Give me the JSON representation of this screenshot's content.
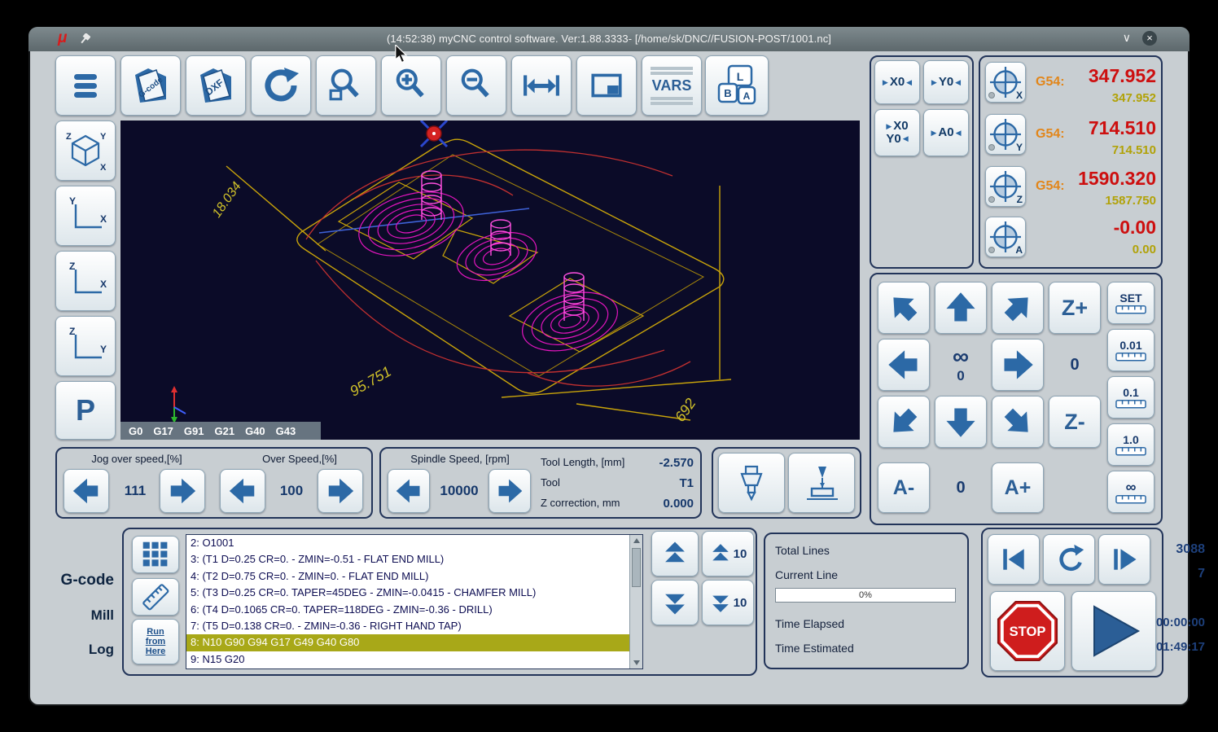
{
  "titlebar": {
    "logo": "μ",
    "title": "(14:52:38) myCNC control software. Ver:1.88.3333- [/home/sk/DNC//FUSION-POST/1001.nc]"
  },
  "glyphs": {
    "minimize": "∨",
    "close": "×",
    "tri_right": "▶",
    "tri_left": "◀"
  },
  "toolbar": {
    "gcode": "G-code",
    "dxf": "DXF",
    "vars": "VARS",
    "keys": {
      "l": "L",
      "b": "B",
      "a": "A"
    }
  },
  "views": {
    "iso": {
      "x": "X",
      "y": "Y",
      "z": "Z"
    },
    "xy": {
      "v": "Y",
      "h": "X"
    },
    "xz": {
      "v": "Z",
      "h": "X"
    },
    "yz": {
      "v": "Z",
      "h": "Y"
    },
    "park": "P"
  },
  "viz": {
    "codes": [
      "G0",
      "G17",
      "G91",
      "G21",
      "G40",
      "G43"
    ],
    "dim_left": "18.034",
    "dim_bottom": "95.751",
    "dim_right": "692"
  },
  "zeroing": {
    "x0": "X0",
    "y0": "Y0",
    "x0y0": [
      "X0",
      "Y0"
    ],
    "a0": "A0"
  },
  "dro": {
    "axes": [
      {
        "axis": "X",
        "offset": "G54:",
        "main": "347.952",
        "sub": "347.952"
      },
      {
        "axis": "Y",
        "offset": "G54:",
        "main": "714.510",
        "sub": "714.510"
      },
      {
        "axis": "Z",
        "offset": "G54:",
        "main": "1590.320",
        "sub": "1587.750"
      },
      {
        "axis": "A",
        "offset": "",
        "main": "-0.00",
        "sub": "0.00"
      }
    ]
  },
  "jog": {
    "z_plus": "Z+",
    "z_minus": "Z-",
    "a_minus": "A-",
    "a_plus": "A+",
    "center_top": "∞",
    "center_bottom": "0",
    "col4_value": "0",
    "a_value": "0",
    "steps": [
      "SET",
      "0.01",
      "0.1",
      "1.0",
      "∞"
    ]
  },
  "overrides": {
    "jog_label": "Jog over speed,[%]",
    "jog_value": "111",
    "over_label": "Over Speed,[%]",
    "over_value": "100",
    "spindle_label": "Spindle Speed, [rpm]",
    "spindle_value": "10000",
    "tool_length_label": "Tool Length, [mm]",
    "tool_length_value": "-2.570",
    "tool_label": "Tool",
    "tool_value": "T1",
    "zcorr_label": "Z correction, mm",
    "zcorr_value": "0.000"
  },
  "gcode_panel": {
    "tabs": [
      "G-code",
      "Mill",
      "Log"
    ],
    "run_from_here": [
      "Run",
      "from",
      "Here"
    ],
    "jump_up": "10",
    "jump_down": "10",
    "highlight_line_number": 8,
    "lines": [
      "2: O1001",
      "3: (T1 D=0.25 CR=0. - ZMIN=-0.51 - FLAT END MILL)",
      "4: (T2 D=0.75 CR=0. - ZMIN=0. - FLAT END MILL)",
      "5: (T3 D=0.25 CR=0. TAPER=45DEG - ZMIN=-0.0415 - CHAMFER MILL)",
      "6: (T4 D=0.1065 CR=0. TAPER=118DEG - ZMIN=-0.36 - DRILL)",
      "7: (T5 D=0.138 CR=0. - ZMIN=-0.36 - RIGHT HAND TAP)",
      "8: N10 G90 G94 G17 G49 G40 G80",
      "9: N15 G20"
    ]
  },
  "progress": {
    "total_lines_label": "Total Lines",
    "total_lines": "3088",
    "current_line_label": "Current Line",
    "current_line": "7",
    "percent": "0%",
    "elapsed_label": "Time Elapsed",
    "elapsed": "00:00:00",
    "estimated_label": "Time Estimated",
    "estimated": "01:49:17"
  },
  "playback": {
    "stop": "STOP"
  }
}
